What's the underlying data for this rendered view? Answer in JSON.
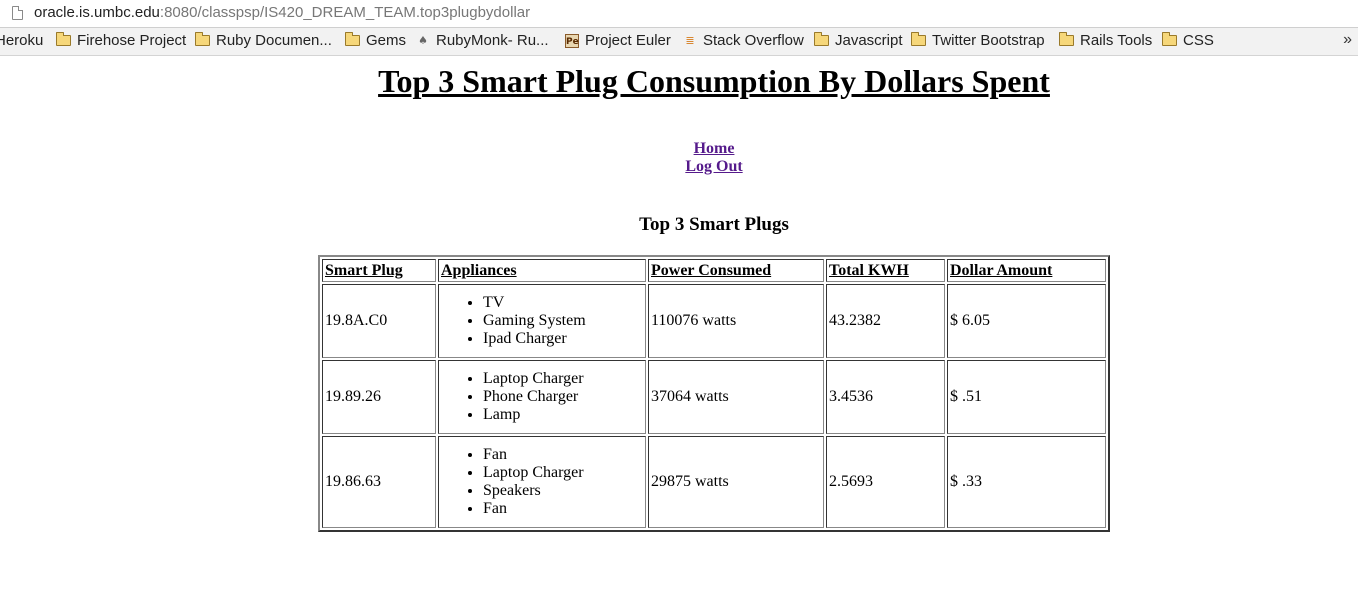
{
  "browser": {
    "url_host": "oracle.is.umbc.edu",
    "url_rest": ":8080/classpsp/IS420_DREAM_TEAM.top3plugbydollar",
    "bookmarks": [
      {
        "label": "Heroku",
        "icon": "none"
      },
      {
        "label": "Firehose Project",
        "icon": "folder-icon"
      },
      {
        "label": "Ruby Documen...",
        "icon": "folder-icon"
      },
      {
        "label": "Gems",
        "icon": "folder-icon"
      },
      {
        "label": "RubyMonk- Ru...",
        "icon": "rubymonk-icon"
      },
      {
        "label": "Project Euler",
        "icon": "project-euler-icon"
      },
      {
        "label": "Stack Overflow",
        "icon": "stack-overflow-icon"
      },
      {
        "label": "Javascript",
        "icon": "folder-icon"
      },
      {
        "label": "Twitter Bootstrap",
        "icon": "folder-icon"
      },
      {
        "label": "Rails Tools",
        "icon": "folder-icon"
      },
      {
        "label": "CSS",
        "icon": "folder-icon"
      }
    ],
    "more": "»"
  },
  "page": {
    "title": "Top 3 Smart Plug Consumption By Dollars Spent",
    "nav": {
      "home": "Home",
      "logout": "Log Out"
    },
    "section_title": "Top 3 Smart Plugs",
    "table": {
      "headers": [
        "Smart Plug",
        "Appliances",
        "Power Consumed",
        "Total KWH",
        "Dollar Amount"
      ],
      "rows": [
        {
          "plug": "19.8A.C0",
          "appliances": [
            "TV",
            "Gaming System",
            "Ipad Charger"
          ],
          "power": "110076 watts",
          "kwh": "43.2382",
          "dollars": "$ 6.05"
        },
        {
          "plug": "19.89.26",
          "appliances": [
            "Laptop Charger",
            "Phone Charger",
            "Lamp"
          ],
          "power": "37064 watts",
          "kwh": "3.4536",
          "dollars": "$ .51"
        },
        {
          "plug": "19.86.63",
          "appliances": [
            "Fan",
            "Laptop Charger",
            "Speakers",
            "Fan"
          ],
          "power": "29875 watts",
          "kwh": "2.5693",
          "dollars": "$ .33"
        }
      ]
    }
  },
  "colors": {
    "link_visited": "#551a8b",
    "folder": "#f6d77a"
  }
}
